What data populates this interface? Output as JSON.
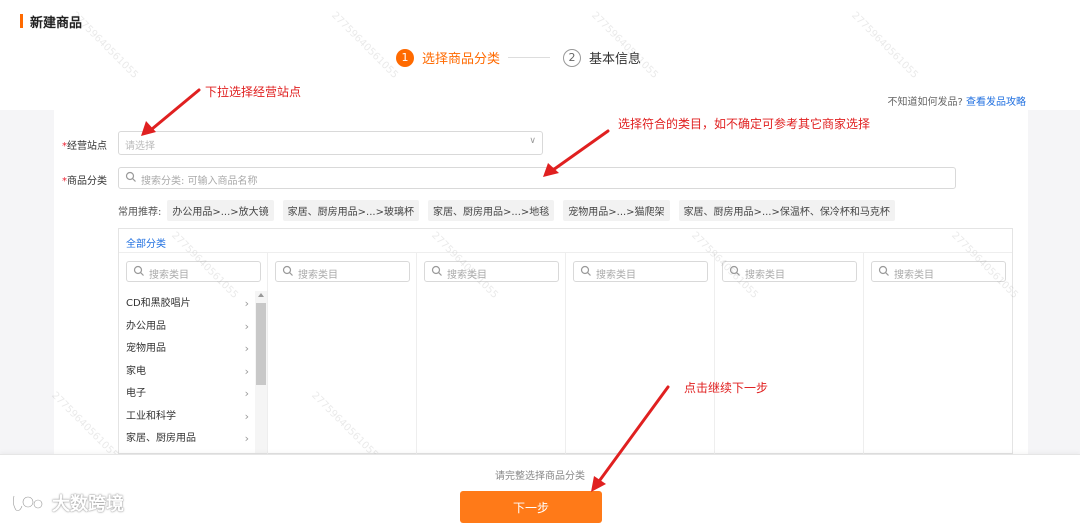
{
  "page": {
    "title": "新建商品"
  },
  "steps": [
    {
      "num": "1",
      "label": "选择商品分类"
    },
    {
      "num": "2",
      "label": "基本信息"
    }
  ],
  "help": {
    "prefix": "不知道如何发品?",
    "link": "查看发品攻略"
  },
  "form": {
    "site_label": "经营站点",
    "site_placeholder": "请选择",
    "category_label": "商品分类",
    "category_placeholder": "搜索分类: 可输入商品名称",
    "required_mark": "*"
  },
  "recommend": {
    "label": "常用推荐:",
    "chips": [
      "办公用品>...>放大镜",
      "家居、厨房用品>...>玻璃杯",
      "家居、厨房用品>...>地毯",
      "宠物用品>...>猫爬架",
      "家居、厨房用品>...>保温杯、保冷杯和马克杯"
    ]
  },
  "category_panel": {
    "tab": "全部分类",
    "search_placeholder": "搜索类目",
    "items": [
      "CD和黑胶唱片",
      "办公用品",
      "宠物用品",
      "家电",
      "电子",
      "工业和科学",
      "家居、厨房用品"
    ]
  },
  "bottom": {
    "hint": "请完整选择商品分类",
    "next_label": "下一步"
  },
  "annotations": {
    "a1": "下拉选择经营站点",
    "a2": "选择符合的类目，如不确定可参考其它商家选择",
    "a3": "点击继续下一步"
  },
  "logo": {
    "text": "大数跨境"
  },
  "watermark": "27759640561055",
  "colors": {
    "accent": "#ff6a00",
    "link": "#1f6fe0",
    "annotation": "#e02020"
  }
}
